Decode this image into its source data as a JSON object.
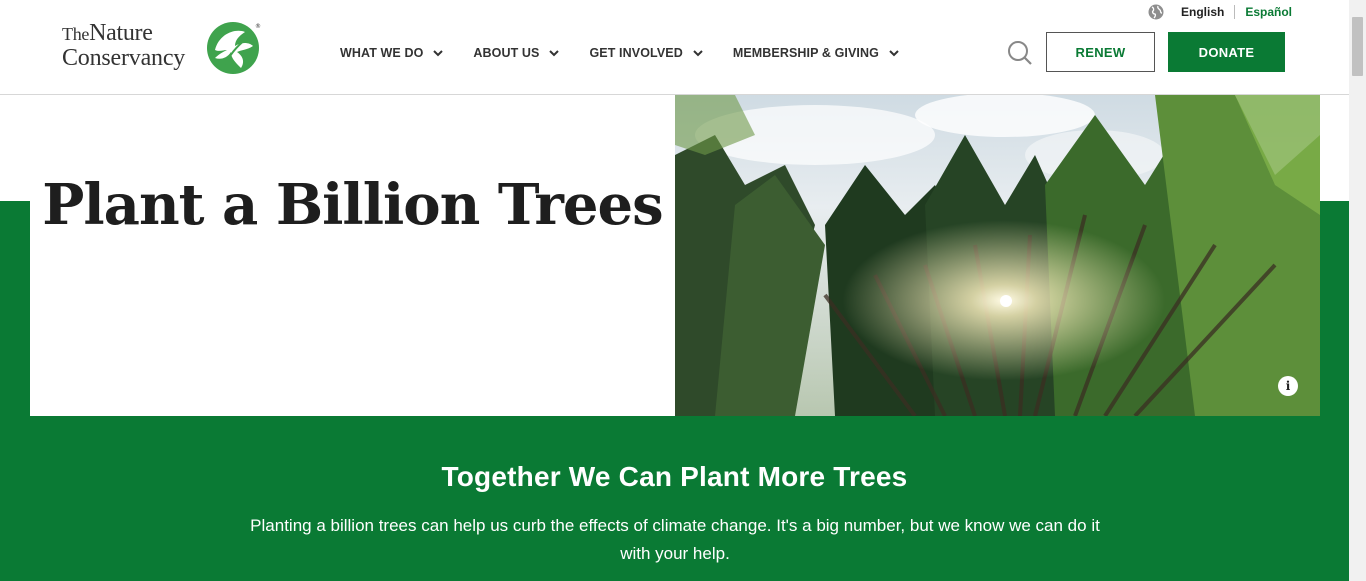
{
  "header": {
    "logo": {
      "line1_prefix": "The",
      "line1": "Nature",
      "line2": "Conservancy"
    },
    "lang": {
      "english": "English",
      "espanol": "Español"
    },
    "nav": [
      {
        "label": "WHAT WE DO"
      },
      {
        "label": "ABOUT US"
      },
      {
        "label": "GET INVOLVED"
      },
      {
        "label": "MEMBERSHIP & GIVING"
      }
    ],
    "renew_label": "RENEW",
    "donate_label": "DONATE"
  },
  "hero": {
    "title": "Plant a Billion Trees",
    "image_icon": "info-icon"
  },
  "section": {
    "title": "Together We Can Plant More Trees",
    "body": "Planting a billion trees can help us curb the effects of climate change. It's a big number, but we know we can do it with your help."
  },
  "colors": {
    "brand_green": "#0a7a34",
    "text_dark": "#222222"
  },
  "icons": [
    "globe-icon",
    "search-icon",
    "chevron-down-icon",
    "info-icon",
    "leaf-logo-icon"
  ]
}
